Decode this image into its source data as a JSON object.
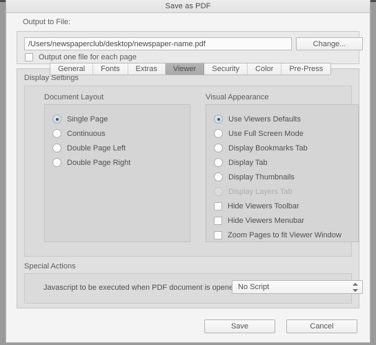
{
  "window": {
    "title": "Save as PDF"
  },
  "output": {
    "label": "Output to File:",
    "path_value": "/Users/newspaperclub/desktop/newspaper-name.pdf",
    "path_placeholder": "/Users/newspaperclub/desktop/newspaper-name.pdf",
    "change_button": "Change...",
    "one_file_per_page_label": "Output one file for each page",
    "one_file_per_page_checked": false
  },
  "tabs": [
    {
      "label": "General",
      "active": false
    },
    {
      "label": "Fonts",
      "active": false
    },
    {
      "label": "Extras",
      "active": false
    },
    {
      "label": "Viewer",
      "active": true
    },
    {
      "label": "Security",
      "active": false
    },
    {
      "label": "Color",
      "active": false
    },
    {
      "label": "Pre-Press",
      "active": false
    }
  ],
  "display_settings": {
    "label": "Display Settings",
    "document_layout": {
      "title": "Document Layout",
      "options": [
        {
          "label": "Single Page",
          "selected": true,
          "disabled": false
        },
        {
          "label": "Continuous",
          "selected": false,
          "disabled": false
        },
        {
          "label": "Double Page Left",
          "selected": false,
          "disabled": false
        },
        {
          "label": "Double Page Right",
          "selected": false,
          "disabled": false
        }
      ]
    },
    "visual_appearance": {
      "title": "Visual Appearance",
      "radios": [
        {
          "label": "Use Viewers Defaults",
          "selected": true,
          "disabled": false
        },
        {
          "label": "Use Full Screen Mode",
          "selected": false,
          "disabled": false
        },
        {
          "label": "Display Bookmarks Tab",
          "selected": false,
          "disabled": false
        },
        {
          "label": "Display Tab",
          "selected": false,
          "disabled": false
        },
        {
          "label": "Display Thumbnails",
          "selected": false,
          "disabled": false
        },
        {
          "label": "Display Layers Tab",
          "selected": false,
          "disabled": true
        }
      ],
      "checkboxes": [
        {
          "label": "Hide Viewers Toolbar",
          "checked": false
        },
        {
          "label": "Hide Viewers Menubar",
          "checked": false
        },
        {
          "label": "Zoom Pages to fit Viewer Window",
          "checked": false
        }
      ]
    }
  },
  "special_actions": {
    "label": "Special Actions",
    "javascript_label": "Javascript to be executed when PDF document is opened:",
    "javascript_value": "No Script",
    "javascript_options": [
      "No Script"
    ]
  },
  "footer": {
    "save_label": "Save",
    "cancel_label": "Cancel"
  },
  "colors": {
    "window_frame": "#9a9a9a",
    "background": "#f4f4f4",
    "panel": "#e0e0e0",
    "group_panel": "#d5d5d5",
    "active_tab": "#adadad",
    "text": "#4f4f4f",
    "disabled_text": "#aeaeae"
  }
}
